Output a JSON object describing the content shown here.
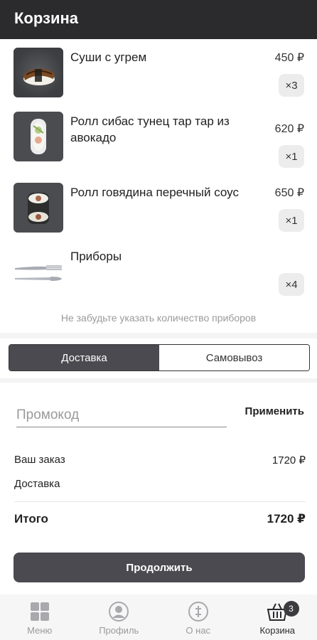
{
  "app_bar": {
    "title": "Корзина"
  },
  "cart": {
    "items": [
      {
        "name": "Суши с угрем",
        "price": "450 ₽",
        "quantity": "×3",
        "image_icon": "eel-sushi-photo"
      },
      {
        "name": "Ролл сибас тунец тар тар из авокадо",
        "price": "620 ₽",
        "quantity": "×1",
        "image_icon": "seabass-roll-photo"
      },
      {
        "name": "Ролл говядина перечный соус",
        "price": "650 ₽",
        "quantity": "×1",
        "image_icon": "beef-roll-photo"
      },
      {
        "name": "Приборы",
        "price": "",
        "quantity": "×4",
        "image_icon": "cutlery-icon"
      }
    ],
    "reminder": "Не забудьте указать количество приборов"
  },
  "delivery_toggle": {
    "options": [
      {
        "label": "Доставка",
        "selected": true
      },
      {
        "label": "Самовывоз",
        "selected": false
      }
    ]
  },
  "promo": {
    "placeholder": "Промокод",
    "value": "",
    "apply_label": "Применить"
  },
  "summary": {
    "order_label": "Ваш заказ",
    "order_value": "1720 ₽",
    "delivery_label": "Доставка",
    "delivery_value": "",
    "total_label": "Итого",
    "total_value": "1720 ₽"
  },
  "continue_label": "Продолжить",
  "bottom_nav": {
    "items": [
      {
        "label": "Меню",
        "icon": "menu-grid-icon",
        "active": false
      },
      {
        "label": "Профиль",
        "icon": "profile-icon",
        "active": false
      },
      {
        "label": "О нас",
        "icon": "info-icon",
        "active": false
      },
      {
        "label": "Корзина",
        "icon": "basket-icon",
        "active": true
      }
    ],
    "cart_badge": "3"
  },
  "colors": {
    "app_bar": "#2b2b2e",
    "accent": "#4b4a50",
    "badge_bg": "#ececec",
    "muted_text": "#9a9a9a"
  }
}
